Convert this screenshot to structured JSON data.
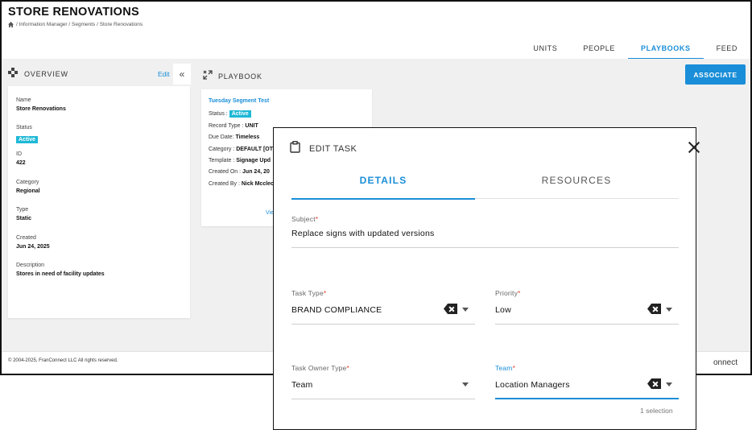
{
  "app": {
    "title": "STORE RENOVATIONS",
    "breadcrumb": "/ Information Manager / Segments / Store Renovations"
  },
  "tabs": [
    {
      "label": "UNITS"
    },
    {
      "label": "PEOPLE"
    },
    {
      "label": "PLAYBOOKS",
      "active": true
    },
    {
      "label": "FEED"
    }
  ],
  "overview": {
    "title": "OVERVIEW",
    "edit_label": "Edit",
    "collapse_label": "«",
    "fields": [
      {
        "label": "Name",
        "value": "Store Renovations"
      },
      {
        "label": "Status",
        "value": "Active"
      },
      {
        "label": "ID",
        "value": "422"
      },
      {
        "label": "Category",
        "value": "Regional"
      },
      {
        "label": "Type",
        "value": "Static"
      },
      {
        "label": "Created",
        "value": "Jun 24, 2025"
      },
      {
        "label": "Description",
        "value": "Stores in need of facility updates"
      }
    ]
  },
  "playbook": {
    "title": "PLAYBOOK",
    "card": {
      "name": "Tuesday Segment Test",
      "status_label": "Status :",
      "status_value": "Active",
      "rows": [
        {
          "label": "Record Type :",
          "value": "UNIT"
        },
        {
          "label": "Due Date:",
          "value": "Timeless"
        },
        {
          "label": "Category :",
          "value": "DEFAULT [OT"
        },
        {
          "label": "Template :",
          "value": "Signage Upd"
        },
        {
          "label": "Created On :",
          "value": "Jun 24, 20"
        },
        {
          "label": "Created By :",
          "value": "Nick Mcclec"
        }
      ],
      "view_label": "Vie"
    }
  },
  "associate_label": "ASSOCIATE",
  "footer": {
    "copyright": "© 2004-2025, FranConnect LLC All rights reserved.",
    "brand": "onnect"
  },
  "modal": {
    "title": "EDIT TASK",
    "tabs": [
      {
        "label": "DETAILS",
        "active": true
      },
      {
        "label": "RESOURCES"
      }
    ],
    "subject": {
      "label": "Subject",
      "value": "Replace signs with updated versions"
    },
    "task_type": {
      "label": "Task Type",
      "value": "BRAND COMPLIANCE"
    },
    "priority": {
      "label": "Priority",
      "value": "Low"
    },
    "task_owner_type": {
      "label": "Task Owner Type",
      "value": "Team"
    },
    "team": {
      "label": "Team",
      "value": "Location Managers"
    },
    "selection_count": "1 selection"
  },
  "colors": {
    "accent": "#1a8ed8",
    "badge": "#1fb8d6",
    "required": "#e0442e"
  },
  "icons": [
    "home-icon",
    "overview-icon",
    "playbook-icon",
    "clipboard-icon",
    "close-icon",
    "clear-icon",
    "caret-down-icon"
  ]
}
